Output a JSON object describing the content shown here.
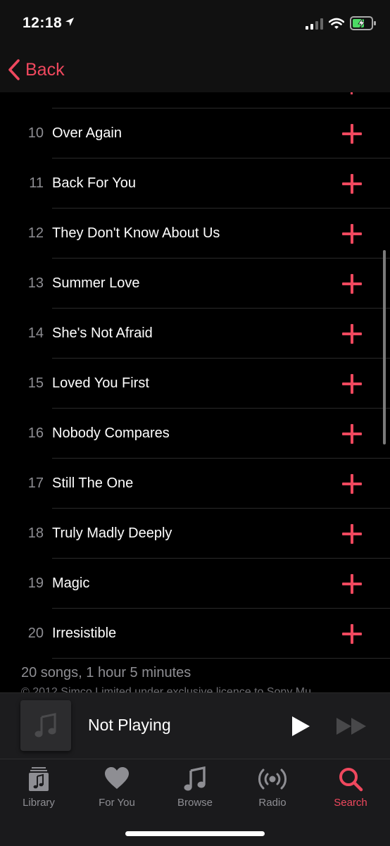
{
  "status_bar": {
    "time": "12:18"
  },
  "nav": {
    "back_label": "Back"
  },
  "tracks": [
    {
      "number": "10",
      "title": "Over Again"
    },
    {
      "number": "11",
      "title": "Back For You"
    },
    {
      "number": "12",
      "title": "They Don't Know About Us"
    },
    {
      "number": "13",
      "title": "Summer Love"
    },
    {
      "number": "14",
      "title": "She's Not Afraid"
    },
    {
      "number": "15",
      "title": "Loved You First"
    },
    {
      "number": "16",
      "title": "Nobody Compares"
    },
    {
      "number": "17",
      "title": "Still The One"
    },
    {
      "number": "18",
      "title": "Truly Madly Deeply"
    },
    {
      "number": "19",
      "title": "Magic"
    },
    {
      "number": "20",
      "title": "Irresistible"
    }
  ],
  "album_summary": "20 songs, 1 hour 5 minutes",
  "copyright": "© 2012 Simco Limited under exclusive licence to Sony Mu",
  "mini_player": {
    "title": "Not Playing"
  },
  "tabs": [
    {
      "label": "Library",
      "icon": "library-icon",
      "active": false
    },
    {
      "label": "For You",
      "icon": "heart-icon",
      "active": false
    },
    {
      "label": "Browse",
      "icon": "music-note-icon",
      "active": false
    },
    {
      "label": "Radio",
      "icon": "radio-icon",
      "active": false
    },
    {
      "label": "Search",
      "icon": "search-icon",
      "active": true
    }
  ],
  "colors": {
    "accent": "#f0485e",
    "background": "#000000",
    "secondary_text": "#8e8e93"
  }
}
